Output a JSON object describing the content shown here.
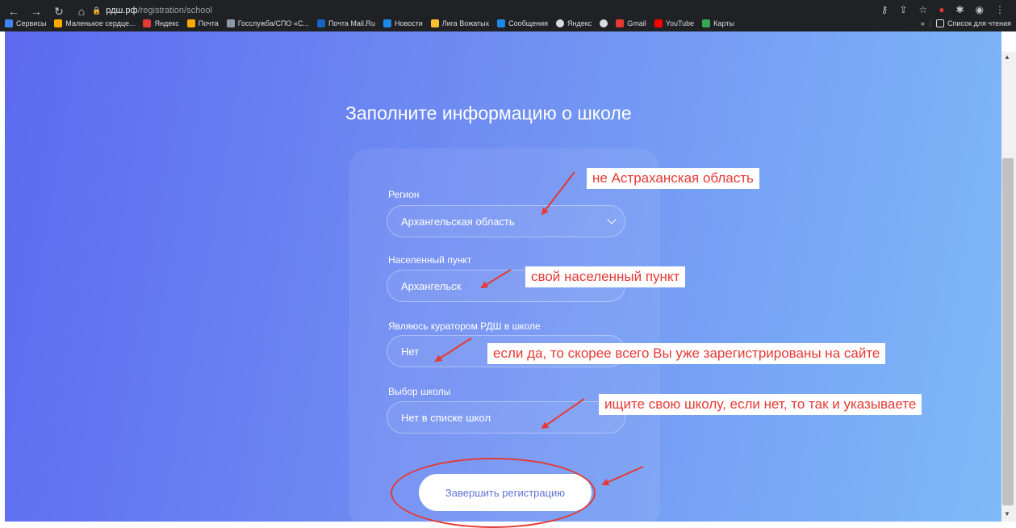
{
  "browser": {
    "url_host": "рдш.рф",
    "url_path": "/registration/school",
    "bookmarks": [
      "Сервисы",
      "Маленькое сердце...",
      "Яндекс",
      "Почта",
      "Госслужба/СПО «С...",
      "Почта Mail.Ru",
      "Новости",
      "Лига Вожатых",
      "Сообщения",
      "Яндекс",
      "Gmail",
      "YouTube",
      "Карты"
    ],
    "reading_list": "Список для чтения",
    "more": "»"
  },
  "form": {
    "title": "Заполните информацию о школе",
    "region": {
      "label": "Регион",
      "value": "Архангельская область"
    },
    "locality": {
      "label": "Населенный пункт",
      "value": "Архангельск"
    },
    "curator": {
      "label": "Являюсь куратором РДШ в школе",
      "value": "Нет"
    },
    "school": {
      "label": "Выбор школы",
      "value": "Нет в списке школ"
    },
    "submit_label": "Завершить регистрацию"
  },
  "annotations": {
    "region_note": "не Астраханская область",
    "locality_note": "свой населенный пункт",
    "curator_note": "если да, то скорее всего Вы уже зарегистрированы на сайте",
    "school_note": "ищите свою школу, если нет, то так и указываете",
    "color": "#e53935"
  },
  "colors": {
    "gradient_start": "#5d6af0",
    "gradient_end": "#7fb9f8",
    "button_text": "#5f73d8"
  }
}
